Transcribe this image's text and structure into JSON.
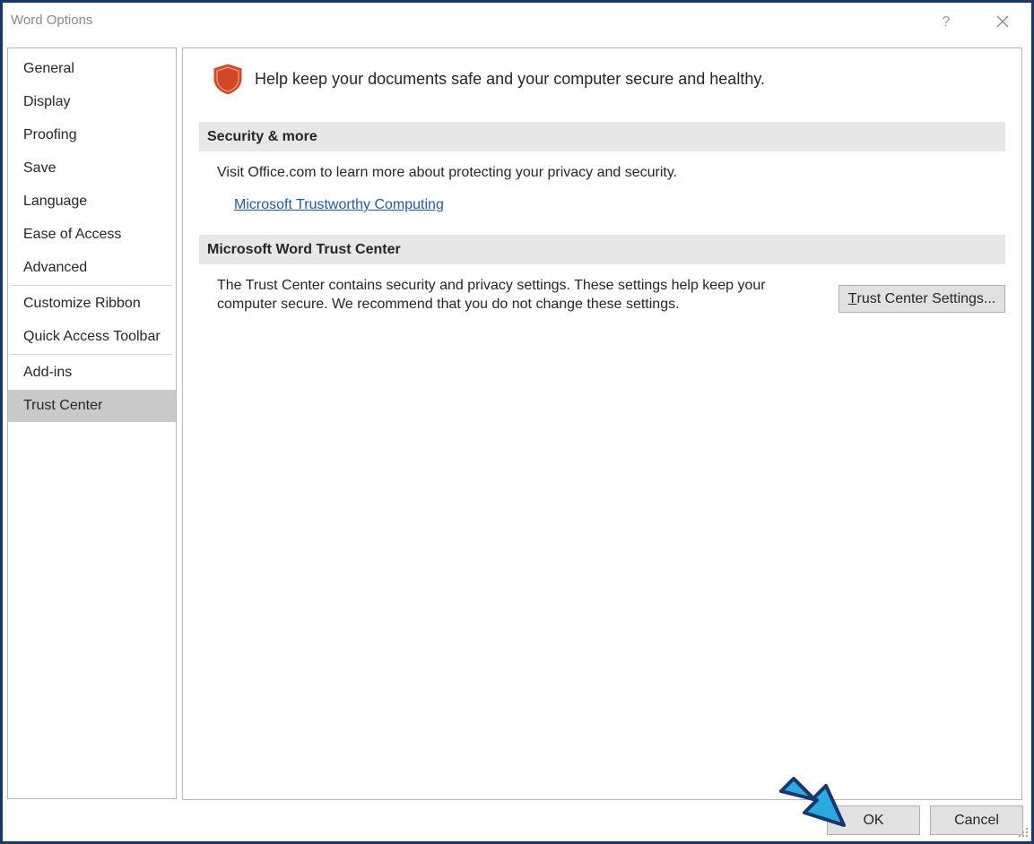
{
  "window": {
    "title": "Word Options",
    "help_glyph": "?",
    "close_icon": "close-icon",
    "border_color": "#17376e"
  },
  "sidebar": {
    "items": [
      {
        "label": "General"
      },
      {
        "label": "Display"
      },
      {
        "label": "Proofing"
      },
      {
        "label": "Save"
      },
      {
        "label": "Language"
      },
      {
        "label": "Ease of Access"
      },
      {
        "label": "Advanced"
      },
      {
        "label": "Customize Ribbon"
      },
      {
        "label": "Quick Access Toolbar"
      },
      {
        "label": "Add-ins"
      },
      {
        "label": "Trust Center"
      }
    ],
    "selected": "Trust Center"
  },
  "main": {
    "header_icon": "shield-icon",
    "header_text": "Help keep your documents safe and your computer secure and healthy.",
    "sections": [
      {
        "title": "Security & more",
        "text": "Visit Office.com to learn more about protecting your privacy and security.",
        "link": "Microsoft Trustworthy Computing"
      },
      {
        "title": "Microsoft Word Trust Center",
        "text_line1": "The Trust Center contains security and privacy settings. These settings help keep your",
        "text_line2": "computer secure. We recommend that you do not change these settings.",
        "button_accel": "T",
        "button_rest": "rust Center Settings..."
      }
    ]
  },
  "footer": {
    "ok_label": "OK",
    "cancel_label": "Cancel"
  },
  "colors": {
    "shield": "#d24726",
    "link": "#1f5aa6",
    "arrow_fill": "#29abe2",
    "arrow_stroke": "#17376e",
    "selected_bg": "#c9c9c9"
  }
}
